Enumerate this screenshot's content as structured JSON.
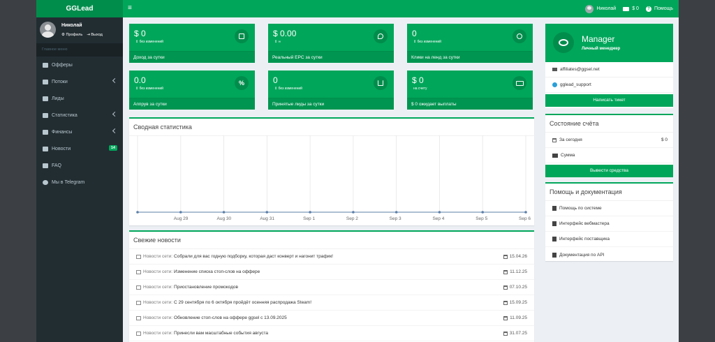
{
  "header": {
    "logo": "GGLead",
    "menu_icon": "≡",
    "user_name": "Николай",
    "balance": "$ 0",
    "help": "Помощь"
  },
  "sidebar": {
    "user_name": "Николай",
    "profile_link": "Профиль",
    "logout_link": "Выход",
    "menu_header": "Главное меню",
    "items": [
      {
        "label": "Офферы",
        "icon": "basket-icon"
      },
      {
        "label": "Потоки",
        "icon": "wrench-icon",
        "chevron": true
      },
      {
        "label": "Лиды",
        "icon": "list-icon"
      },
      {
        "label": "Статистика",
        "icon": "chart-icon",
        "chevron": true
      },
      {
        "label": "Финансы",
        "icon": "money-icon",
        "chevron": true
      },
      {
        "label": "Новости",
        "icon": "news-icon",
        "badge": "14"
      },
      {
        "label": "FAQ",
        "icon": "book-icon"
      },
      {
        "label": "Мы в Telegram",
        "icon": "telegram-icon"
      }
    ]
  },
  "tiles": [
    {
      "value": "0",
      "sub": "без изменений",
      "footer": "Доход за сутки",
      "icon": "area-chart-icon"
    },
    {
      "value": "0.00",
      "sub": "∞",
      "footer": "Реальный EPC за сутки",
      "icon": "fire-icon"
    },
    {
      "value": "0",
      "sub": "без изменений",
      "footer": "Клики на ленд за сутки",
      "icon": "pointer-icon"
    },
    {
      "value": "0.0",
      "sub": "без изменений",
      "footer": "Аппрув за сутки",
      "icon": "percent-icon"
    },
    {
      "value": "0",
      "sub": "без изменений",
      "footer": "Принятые лиды за сутки",
      "icon": "basket-icon"
    },
    {
      "value": "0",
      "sub": "на счету",
      "footer": "$ 0 ожидает выплаты",
      "icon": "money-icon"
    }
  ],
  "stats": {
    "title": "Сводная статистика"
  },
  "chart_data": {
    "type": "line",
    "x": [
      "",
      "Aug 29",
      "Aug 30",
      "Aug 31",
      "Sep 1",
      "Sep 2",
      "Sep 3",
      "Sep 4",
      "Sep 5",
      "Sep 6"
    ],
    "series": [
      {
        "values": [
          0,
          0,
          0,
          0,
          0,
          0,
          0,
          0,
          0,
          0
        ]
      }
    ],
    "grid": true,
    "line_color": "#5b7fa8"
  },
  "news": {
    "title": "Свежие новости",
    "prefix": "Новости сети:",
    "rows": [
      {
        "title": "Собрали для вас годную подборку, которая даст конверт и нагонит трафик!",
        "date": "15.04.26"
      },
      {
        "title": "Изменение списка стоп-слов на оффере",
        "date": "11.12.25"
      },
      {
        "title": "Приостановление промокодов",
        "date": "07.10.25"
      },
      {
        "title": "С 29 сентября по 6 октября пройдёт осенняя распродажа Steam!",
        "date": "15.09.25"
      },
      {
        "title": "Обновление стоп-слов на оффере ggsel с 13.09.2025",
        "date": "11.09.25"
      },
      {
        "title": "Принесли вам масштабные события августа",
        "date": "31.07.25"
      }
    ]
  },
  "manager": {
    "title": "Manager",
    "subtitle": "Личный менеджер",
    "email": "affiliates@ggsel.net",
    "telegram": "gglead_support",
    "ticket_button": "Написать тикет"
  },
  "account": {
    "title": "Состояние счёта",
    "today_label": "За сегодня",
    "today_value": "$ 0",
    "sum_label": "Сумма",
    "withdraw_button": "Вывести средства"
  },
  "docs": {
    "title": "Помощь и документация",
    "items": [
      "Помощь по системе",
      "Интерфейс вебмастера",
      "Интерфейс поставщика",
      "Документация по API"
    ]
  },
  "colors": {
    "green": "#00a65a",
    "dark_green": "#008d4c",
    "sidebar": "#222d32"
  }
}
